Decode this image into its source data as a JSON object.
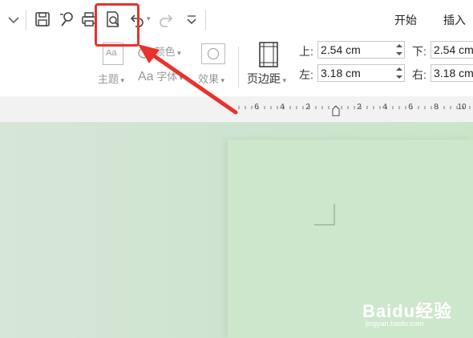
{
  "menu": {
    "start": "开始",
    "insert": "插入"
  },
  "ribbon": {
    "theme_label": "主题",
    "theme_icon_text": "Aa",
    "color_label": "颜色",
    "font_label": "字体",
    "font_prefix": "Aa",
    "effect_label": "效果",
    "margins_label": "页边距"
  },
  "margins": {
    "top_label": "上:",
    "top_value": "2.54 cm",
    "left_label": "左:",
    "left_value": "3.18 cm",
    "bottom_label": "下:",
    "bottom_value": "2.54 cm",
    "right_label": "右:",
    "right_value": "3.18 cm"
  },
  "ruler": {
    "ticks": [
      "6",
      "4",
      "2",
      "",
      "2",
      "4",
      "6",
      "8",
      "10"
    ]
  },
  "watermark": {
    "brand": "Baidu经验",
    "url": "jingyan.baidu.com"
  },
  "colors": {
    "highlight": "#e8322b",
    "page": "#cce7cb"
  }
}
